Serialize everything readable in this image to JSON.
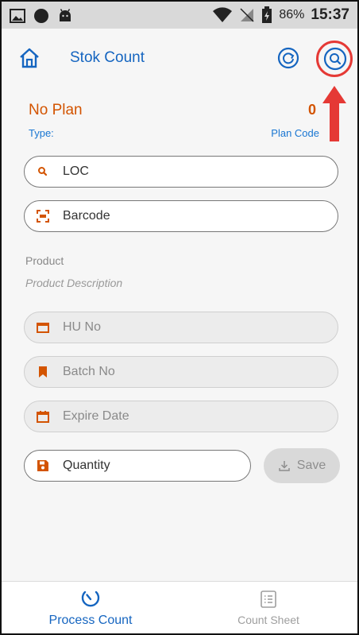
{
  "status_bar": {
    "battery": "86%",
    "time": "15:37",
    "icons": [
      "image-icon",
      "circle-icon",
      "android-icon",
      "wifi-icon",
      "no-sim-icon",
      "battery-icon"
    ]
  },
  "app_bar": {
    "title": "Stok Count",
    "icons": [
      "home-icon",
      "refresh-icon",
      "search-icon"
    ]
  },
  "plan": {
    "name": "No Plan",
    "type_label": "Type:",
    "count": "0",
    "code_label": "Plan Code"
  },
  "form": {
    "loc_label": "LOC",
    "barcode_label": "Barcode",
    "product_label": "Product",
    "product_description": "Product Description",
    "hu_label": "HU No",
    "batch_label": "Batch No",
    "expire_label": "Expire Date",
    "quantity_label": "Quantity",
    "save_label": "Save"
  },
  "bottom_nav": {
    "items": [
      {
        "label": "Process Count",
        "icon": "timer-icon",
        "active": true
      },
      {
        "label": "Count Sheet",
        "icon": "list-icon",
        "active": false
      }
    ]
  },
  "colors": {
    "primary": "#1565c0",
    "accent": "#d35400",
    "annotation": "#e53935"
  }
}
